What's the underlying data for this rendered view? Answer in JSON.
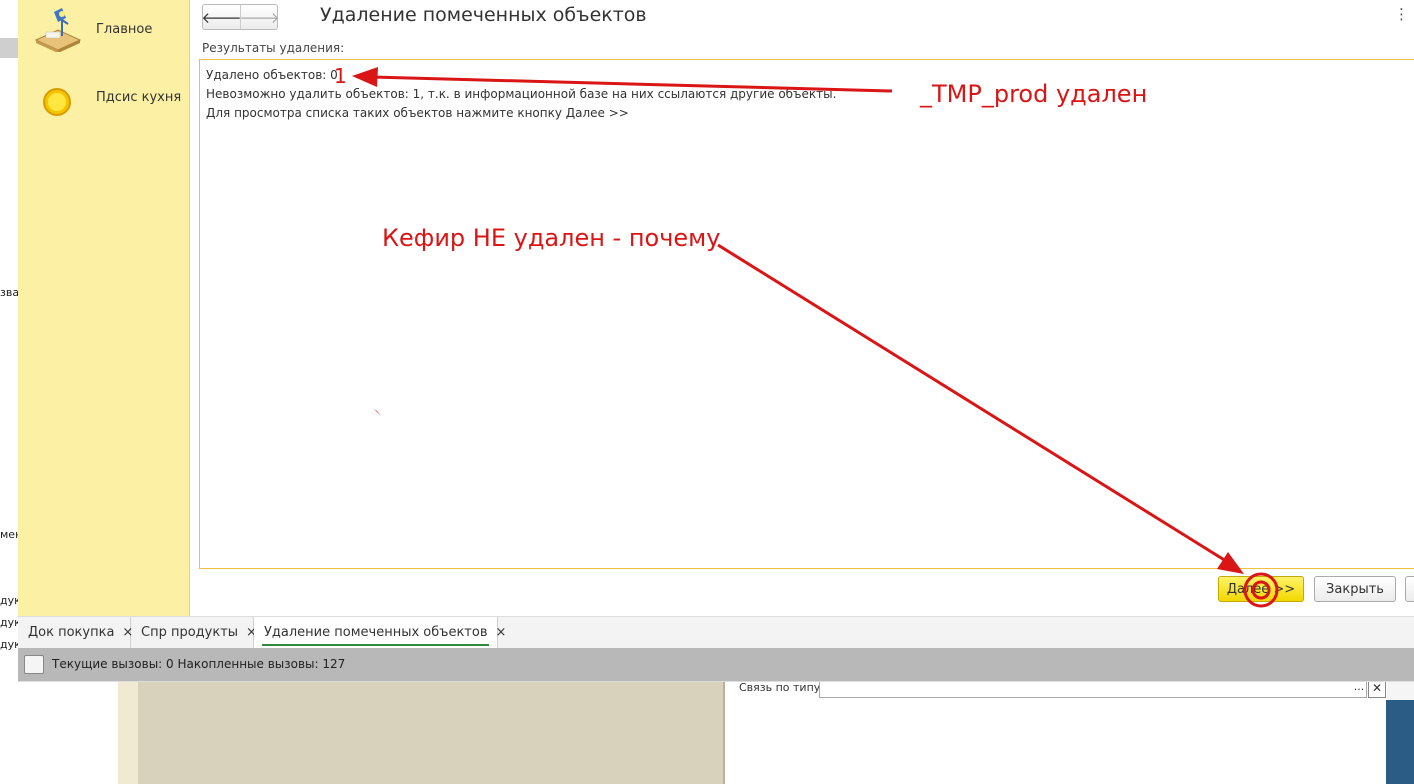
{
  "window": {
    "title": "Удаление помеченных объектов",
    "more_glyph": "⋮",
    "nav": {
      "back_glyph": "🡐",
      "forward_glyph": "🡒"
    }
  },
  "sidebar": {
    "items": [
      {
        "label": "Главное",
        "icon": "desk-lamp-icon"
      },
      {
        "label": "Пдсис кухня",
        "icon": "yellow-circle-icon"
      }
    ]
  },
  "results": {
    "label": "Результаты удаления:",
    "lines": [
      "Удалено объектов: 0",
      "Невозможно удалить объектов: 1, т.к. в информационной базе на них ссылаются другие объекты.",
      "Для просмотра списка таких объектов нажмите кнопку Далее >>"
    ]
  },
  "buttons": {
    "next": "Далее >>",
    "close": "Закрыть"
  },
  "tabs": [
    {
      "label": "Док покупка",
      "close": "×"
    },
    {
      "label": "Спр продукты",
      "close": "×"
    },
    {
      "label": "Удаление помеченных объектов",
      "close": "×",
      "active": true
    }
  ],
  "status": {
    "text": "Текущие вызовы: 0   Накопленные вызовы: 127"
  },
  "background": {
    "fragments": [
      "зва",
      "мен",
      "дук",
      "дук",
      "дук"
    ],
    "field_label": "Связь по типу",
    "field_btn_dots": "...",
    "field_btn_clear": "✕"
  },
  "annotations": {
    "handwritten_one": "1",
    "tmp_prod": "_TMP_prod удален",
    "kefir": "Кефир НЕ удален - почему",
    "arrow_color": "#d91515"
  }
}
